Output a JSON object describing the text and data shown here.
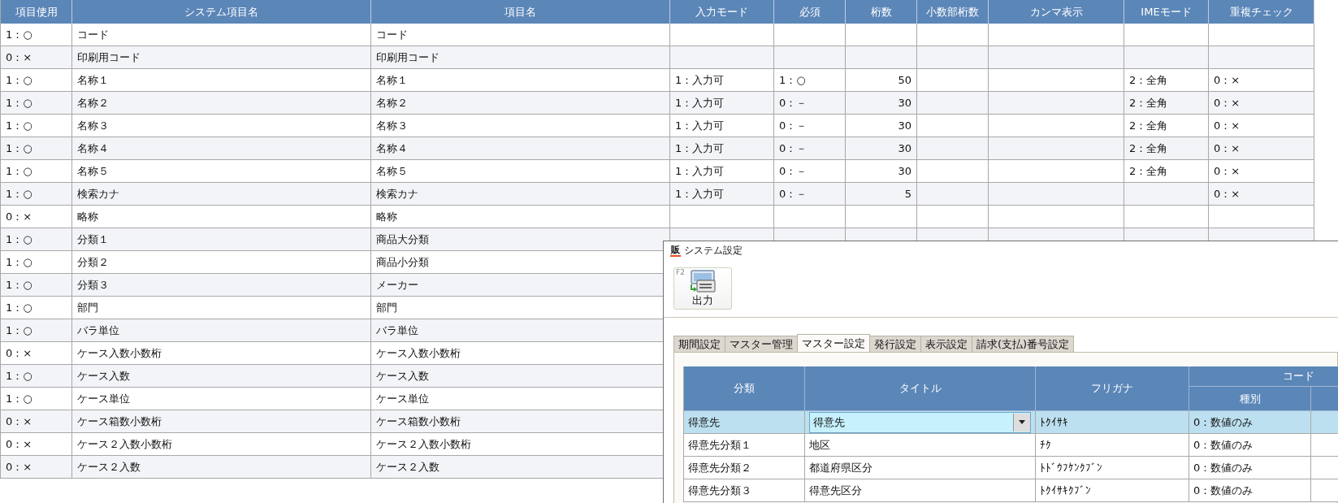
{
  "table": {
    "columns": [
      "項目使用",
      "システム項目名",
      "項目名",
      "入力モード",
      "必須",
      "桁数",
      "小数部桁数",
      "カンマ表示",
      "IMEモード",
      "重複チェック"
    ],
    "rows": [
      {
        "cells": [
          "1：○",
          "コード",
          "コード",
          "",
          "",
          "",
          "",
          "",
          "",
          ""
        ]
      },
      {
        "cells": [
          "0：×",
          "印刷用コード",
          "印刷用コード",
          "",
          "",
          "",
          "",
          "",
          "",
          ""
        ]
      },
      {
        "cells": [
          "1：○",
          "名称１",
          "名称１",
          "1：入力可",
          "1：○",
          "50",
          "",
          "",
          "2：全角",
          "0：×"
        ]
      },
      {
        "cells": [
          "1：○",
          "名称２",
          "名称２",
          "1：入力可",
          "0：－",
          "30",
          "",
          "",
          "2：全角",
          "0：×"
        ]
      },
      {
        "cells": [
          "1：○",
          "名称３",
          "名称３",
          "1：入力可",
          "0：－",
          "30",
          "",
          "",
          "2：全角",
          "0：×"
        ]
      },
      {
        "cells": [
          "1：○",
          "名称４",
          "名称４",
          "1：入力可",
          "0：－",
          "30",
          "",
          "",
          "2：全角",
          "0：×"
        ]
      },
      {
        "cells": [
          "1：○",
          "名称５",
          "名称５",
          "1：入力可",
          "0：－",
          "30",
          "",
          "",
          "2：全角",
          "0：×"
        ]
      },
      {
        "cells": [
          "1：○",
          "検索カナ",
          "検索カナ",
          "1：入力可",
          "0：－",
          "5",
          "",
          "",
          "",
          "0：×"
        ]
      },
      {
        "cells": [
          "0：×",
          "略称",
          "略称",
          "",
          "",
          "",
          "",
          "",
          "",
          ""
        ]
      },
      {
        "cells": [
          "1：○",
          "分類１",
          "商品大分類",
          "",
          "",
          "",
          "",
          "",
          "",
          ""
        ]
      },
      {
        "cells": [
          "1：○",
          "分類２",
          "商品小分類"
        ]
      },
      {
        "cells": [
          "1：○",
          "分類３",
          "メーカー"
        ]
      },
      {
        "cells": [
          "1：○",
          "部門",
          "部門"
        ]
      },
      {
        "cells": [
          "1：○",
          "バラ単位",
          "バラ単位"
        ]
      },
      {
        "cells": [
          "0：×",
          "ケース入数小数桁",
          "ケース入数小数桁"
        ]
      },
      {
        "cells": [
          "1：○",
          "ケース入数",
          "ケース入数"
        ]
      },
      {
        "cells": [
          "1：○",
          "ケース単位",
          "ケース単位"
        ]
      },
      {
        "cells": [
          "0：×",
          "ケース箱数小数桁",
          "ケース箱数小数桁"
        ]
      },
      {
        "cells": [
          "0：×",
          "ケース２入数小数桁",
          "ケース２入数小数桁"
        ]
      },
      {
        "cells": [
          "0：×",
          "ケース２入数",
          "ケース２入数"
        ]
      }
    ]
  },
  "dialog": {
    "logo": "販",
    "title": "システム設定",
    "toolbar": [
      {
        "key": "F2",
        "label": "出力"
      }
    ],
    "tabs": [
      {
        "label": "期間設定",
        "selected": false
      },
      {
        "label": "マスター管理",
        "selected": false
      },
      {
        "label": "マスター設定",
        "selected": true
      },
      {
        "label": "発行設定",
        "selected": false
      },
      {
        "label": "表示設定",
        "selected": false
      },
      {
        "label": "請求(支払)番号設定",
        "selected": false
      }
    ],
    "grid": {
      "columns": [
        "分類",
        "タイトル",
        "フリガナ"
      ],
      "group_header": "コード",
      "sub_columns": [
        "種別"
      ],
      "rows": [
        {
          "selected": true,
          "cells": [
            "得意先",
            "得意先",
            "ﾄｸｲｻｷ",
            "0：数値のみ"
          ]
        },
        {
          "selected": false,
          "cells": [
            "得意先分類１",
            "地区",
            "ﾁｸ",
            "0：数値のみ"
          ]
        },
        {
          "selected": false,
          "cells": [
            "得意先分類２",
            "都道府県区分",
            "ﾄﾄﾞｳﾌｹﾝｸﾌﾞﾝ",
            "0：数値のみ"
          ]
        },
        {
          "selected": false,
          "cells": [
            "得意先分類３",
            "得意先区分",
            "ﾄｸｲｻｷｸﾌﾞﾝ",
            "0：数値のみ"
          ]
        }
      ]
    }
  }
}
